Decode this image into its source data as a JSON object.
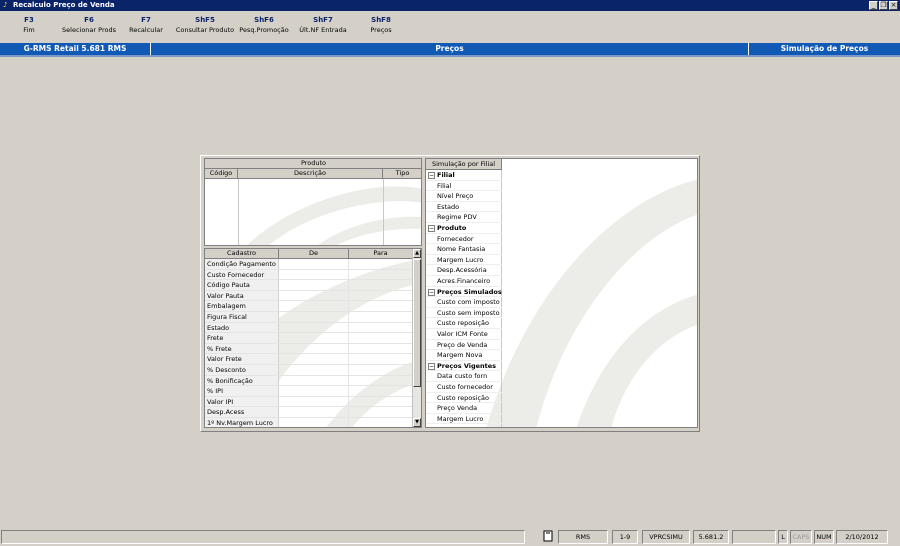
{
  "window": {
    "title": "Recalculo Preço de Venda",
    "icon": "app-icon"
  },
  "toolbar": {
    "buttons": [
      {
        "key": "F3",
        "label": "Fim"
      },
      {
        "key": "F6",
        "label": "Selecionar Prods"
      },
      {
        "key": "F7",
        "label": "Recalcular"
      },
      {
        "key": "ShF5",
        "label": "Consultar Produto"
      },
      {
        "key": "ShF6",
        "label": "Pesq.Promoção"
      },
      {
        "key": "ShF7",
        "label": "Últ.NF Entrada"
      },
      {
        "key": "ShF8",
        "label": "Preços"
      }
    ]
  },
  "header": {
    "left": "G-RMS Retail 5.681 RMS",
    "center": "Preços",
    "right": "Simulação de Preços"
  },
  "produto_grid": {
    "title": "Produto",
    "columns": [
      "Código",
      "Descrição",
      "Tipo"
    ]
  },
  "cadastro_grid": {
    "columns": [
      "Cadastro",
      "De",
      "Para"
    ],
    "rows": [
      "Condição Pagamento",
      "Custo Fornecedor",
      "Código Pauta",
      "Valor Pauta",
      "Embalagem",
      "Figura Fiscal",
      "Estado",
      "Frete",
      "% Frete",
      "Valor Frete",
      "% Desconto",
      "% Bonificação",
      "% IPI",
      "Valor IPI",
      "Desp.Acess",
      "1º Nv.Margem Lucro"
    ]
  },
  "simulacao": {
    "header": "Simulação por Filial",
    "groups": [
      {
        "title": "Filial",
        "items": [
          "Filial",
          "Nível Preço",
          "Estado",
          "Regime PDV"
        ]
      },
      {
        "title": "Produto",
        "items": [
          "Fornecedor",
          "Nome Fantasia",
          "Margem Lucro",
          "Desp.Acessória",
          "Acres.Financeiro"
        ]
      },
      {
        "title": "Preços Simulados",
        "items": [
          "Custo com imposto",
          "Custo sem imposto",
          "Custo reposição",
          "Valor ICM Fonte",
          "Preço de Venda",
          "Margem Nova"
        ]
      },
      {
        "title": "Preços Vigentes",
        "items": [
          "Data custo forn",
          "Custo fornecedor",
          "Custo reposição",
          "Preço Venda",
          "Margem Lucro"
        ]
      }
    ]
  },
  "statusbar": {
    "user": "RMS",
    "page": "1-9",
    "program": "VPRCSIMU",
    "version": "5.681.2",
    "l": "L",
    "caps": "CAPS",
    "num": "NUM",
    "date": "2/10/2012"
  },
  "colors": {
    "title_bar": "#0a246a",
    "header_bar": "#1059b5",
    "key_text": "#0a246a",
    "face": "#d4d0c8"
  }
}
